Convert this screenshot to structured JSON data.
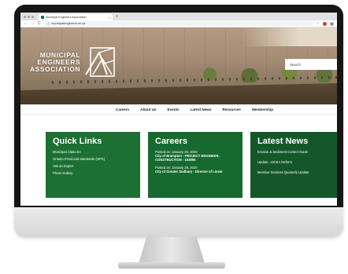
{
  "browser": {
    "tab_title": "Municipal Engineers Association",
    "tab_close": "×",
    "new_tab": "+",
    "back": "←",
    "forward": "→",
    "reload": "C",
    "url": "municipalengineers.on.ca",
    "bookmark": "☆"
  },
  "hero": {
    "logo_lines": [
      "MUNICIPAL",
      "ENGINEERS",
      "ASSOCIATION"
    ],
    "search_placeholder": "Search"
  },
  "nav": {
    "items": [
      "Careers",
      "About Us",
      "Events",
      "Latest News",
      "Resources",
      "Membership"
    ]
  },
  "quick_links": {
    "title": "Quick Links",
    "items": [
      "Municipal Class EA",
      "Ontario Provincial Standards (OPS)",
      "Ask an Expert",
      "Photo Gallery"
    ]
  },
  "careers": {
    "title": "Careers",
    "jobs": [
      {
        "date": "Posted on: January 28, 2020",
        "title": "City of Brampton - PROJECT ENGINEER, CONSTRUCTION - 103895"
      },
      {
        "date": "Posted on: January 28, 2020",
        "title": "City of Greater Sudbury - Director of Linear"
      }
    ]
  },
  "latest_news": {
    "title": "Latest News",
    "items": [
      "Erosion & Sediment Control Guide",
      "Update - MCEA Reform",
      "Member Services Quarterly Update"
    ]
  },
  "colors": {
    "panel_green": "#1d7034",
    "panel_dark_green": "#14582a",
    "bezel": "#161616"
  }
}
